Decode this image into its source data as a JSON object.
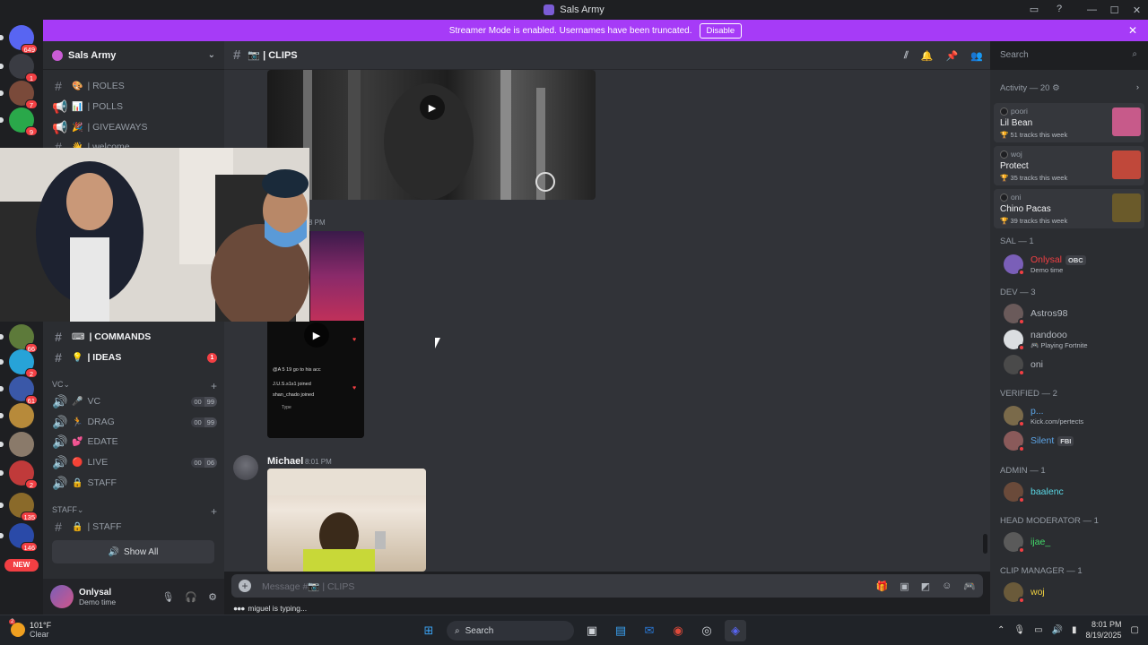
{
  "window": {
    "title": "Sals Army",
    "controls": [
      "—",
      "☐",
      "✕"
    ]
  },
  "banner": {
    "text": "Streamer Mode is enabled. Usernames have been truncated.",
    "button": "Disable"
  },
  "guilds": [
    {
      "badge": "649",
      "color": "#5865f2"
    },
    {
      "badge": "1",
      "color": "#3a3c43"
    },
    {
      "badge": "7",
      "color": "#7a4a3a"
    },
    {
      "badge": "9",
      "color": "#2aa84a"
    },
    {
      "badge": "66",
      "color": "#5d7a3a"
    },
    {
      "badge": "2",
      "color": "#27a3d8"
    },
    {
      "badge": "61",
      "color": "#3a58a8"
    },
    {
      "badge": "",
      "color": "#b78a3a"
    },
    {
      "badge": "",
      "color": "#8a7a6a"
    },
    {
      "badge": "2",
      "color": "#c03a3a"
    },
    {
      "badge": "135",
      "color": "#8a6a2a"
    },
    {
      "badge": "146",
      "color": "#2a4aa8"
    }
  ],
  "new_badge": "NEW",
  "server": {
    "name": "Sals Army"
  },
  "channels": [
    {
      "emoji": "🎨",
      "label": "| ROLES",
      "type": "text"
    },
    {
      "emoji": "📊",
      "label": "| POLLS",
      "type": "announce"
    },
    {
      "emoji": "🎉",
      "label": "| GIVEAWAYS",
      "type": "announce"
    },
    {
      "emoji": "👋",
      "label": "| welcome",
      "type": "text"
    },
    {
      "emoji": "⌨",
      "label": "| COMMANDS",
      "type": "text"
    },
    {
      "emoji": "💡",
      "label": "| IDEAS",
      "type": "text",
      "unread": "1"
    }
  ],
  "voice_category": "VC",
  "voice": [
    {
      "emoji": "🎤",
      "label": "VC",
      "count": [
        "00",
        "99"
      ]
    },
    {
      "emoji": "🏃",
      "label": "DRAG",
      "count": [
        "00",
        "99"
      ]
    },
    {
      "emoji": "💕",
      "label": "EDATE",
      "count": []
    },
    {
      "emoji": "🔴",
      "label": "LIVE",
      "count": [
        "00",
        "06"
      ]
    },
    {
      "emoji": "🔒",
      "label": "STAFF",
      "count": []
    }
  ],
  "staff_category": "STAFF",
  "staff_channel": {
    "emoji": "🔒",
    "label": "| STAFF"
  },
  "show_all": "Show All",
  "user": {
    "name": "Onlysal",
    "status": "Demo time"
  },
  "chat": {
    "channel": "📷 | CLIPS",
    "time_partial": "8 PM",
    "author": "Michael",
    "time": "8:01 PM",
    "placeholder": "Message #📷 | CLIPS",
    "typing": "miguel is typing...",
    "typing_dots": "●●●"
  },
  "phone_overlay": {
    "l1": "@A 5 19 go to his acc",
    "l2": "J.U.S.s1s1 joined",
    "l3": "shan_chado joined",
    "input": "Type"
  },
  "search": {
    "placeholder": "Search"
  },
  "activity": {
    "header": "Activity — 20",
    "items": [
      {
        "user": "poori",
        "song": "Lil Bean",
        "tracks": "51 tracks this week",
        "art": "#c75a8a"
      },
      {
        "user": "woj",
        "song": "Protect",
        "tracks": "35 tracks this week",
        "art": "#c0483a"
      },
      {
        "user": "oni",
        "song": "Chino Pacas",
        "tracks": "39 tracks this week",
        "art": "#6a5a2a"
      }
    ]
  },
  "roles": [
    {
      "title": "SAL — 1",
      "members": [
        {
          "name": "Onlysal",
          "color": "#f23f43",
          "tag": "OBC",
          "sub": "Demo time",
          "av": "#7a5fb8"
        }
      ]
    },
    {
      "title": "DEV — 3",
      "members": [
        {
          "name": "Astros98",
          "color": "#b5bac1",
          "av": "#6a5a5a"
        },
        {
          "name": "nandooo",
          "color": "#b5bac1",
          "sub": "🎮 Playing Fortnite",
          "av": "#dbdee1"
        },
        {
          "name": "oni",
          "color": "#b5bac1",
          "av": "#4a4a4a"
        }
      ]
    },
    {
      "title": "VERIFIED — 2",
      "members": [
        {
          "name": "p...",
          "color": "#5ca4e6",
          "sub": "Kick.com/pertects",
          "av": "#7a6a4a"
        },
        {
          "name": "Silent",
          "color": "#5ca4e6",
          "tag": "FBI",
          "av": "#8a5a5a"
        }
      ]
    },
    {
      "title": "ADMIN — 1",
      "members": [
        {
          "name": "baalenc",
          "color": "#5ad8e6",
          "av": "#6a4a3a"
        }
      ]
    },
    {
      "title": "HEAD MODERATOR — 1",
      "members": [
        {
          "name": "ijae_",
          "color": "#43d96a",
          "av": "#5a5a5a"
        }
      ]
    },
    {
      "title": "CLIP MANAGER — 1",
      "members": [
        {
          "name": "woj",
          "color": "#f0d040",
          "av": "#6a5a3a"
        }
      ]
    }
  ],
  "taskbar": {
    "weather_temp": "101°F",
    "weather_desc": "Clear",
    "weather_badge": "2",
    "search": "Search",
    "time": "8:01 PM",
    "date": "8/19/2025"
  }
}
